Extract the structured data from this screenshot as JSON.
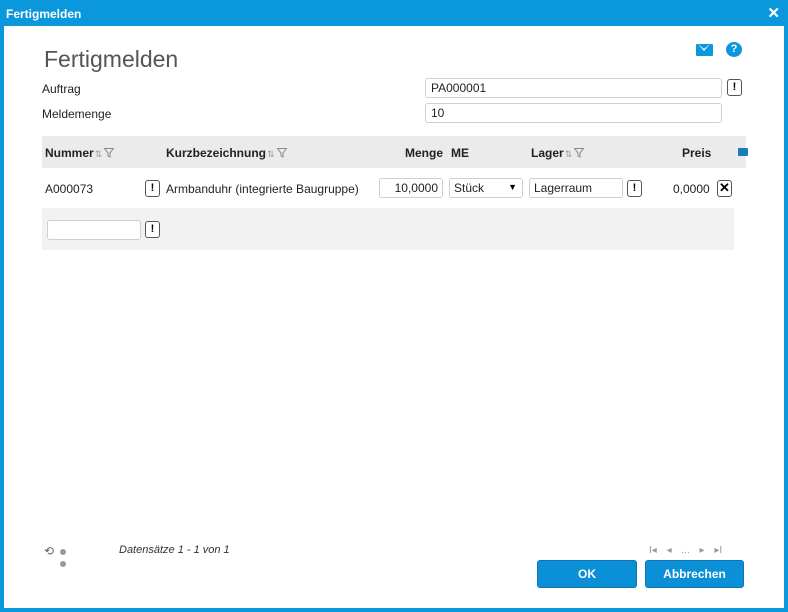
{
  "window": {
    "title": "Fertigmelden",
    "close_glyph": "✕"
  },
  "page": {
    "heading": "Fertigmelden"
  },
  "icons": {
    "mail": "mail-icon",
    "help": "help-icon",
    "help_glyph": "?"
  },
  "form": {
    "auftrag_label": "Auftrag",
    "auftrag_value": "PA000001",
    "meldemenge_label": "Meldemenge",
    "meldemenge_value": "10",
    "info_glyph": "!"
  },
  "table": {
    "columns": {
      "nummer": "Nummer",
      "kurzbezeichnung": "Kurzbezeichnung",
      "menge": "Menge",
      "me": "ME",
      "lager": "Lager",
      "preis": "Preis"
    },
    "rows": [
      {
        "nummer": "A000073",
        "kurzbezeichnung": "Armbanduhr (integrierte Baugruppe)",
        "menge": "10,0000",
        "me": "Stück",
        "lager": "Lagerraum",
        "preis": "0,0000"
      }
    ],
    "new_row": {
      "nummer": ""
    },
    "delete_glyph": "✕"
  },
  "footer": {
    "records_text": "Datensätze 1 - 1 von 1",
    "pager": {
      "first": "I◂",
      "prev": "◂",
      "ellipsis": "...",
      "next": "▸",
      "last": "▸I"
    },
    "refresh_glyph": "⟲"
  },
  "buttons": {
    "ok": "OK",
    "cancel": "Abbrechen"
  },
  "colors": {
    "accent": "#0b97db",
    "button": "#0b8fd6",
    "header_bg": "#ebebeb"
  }
}
